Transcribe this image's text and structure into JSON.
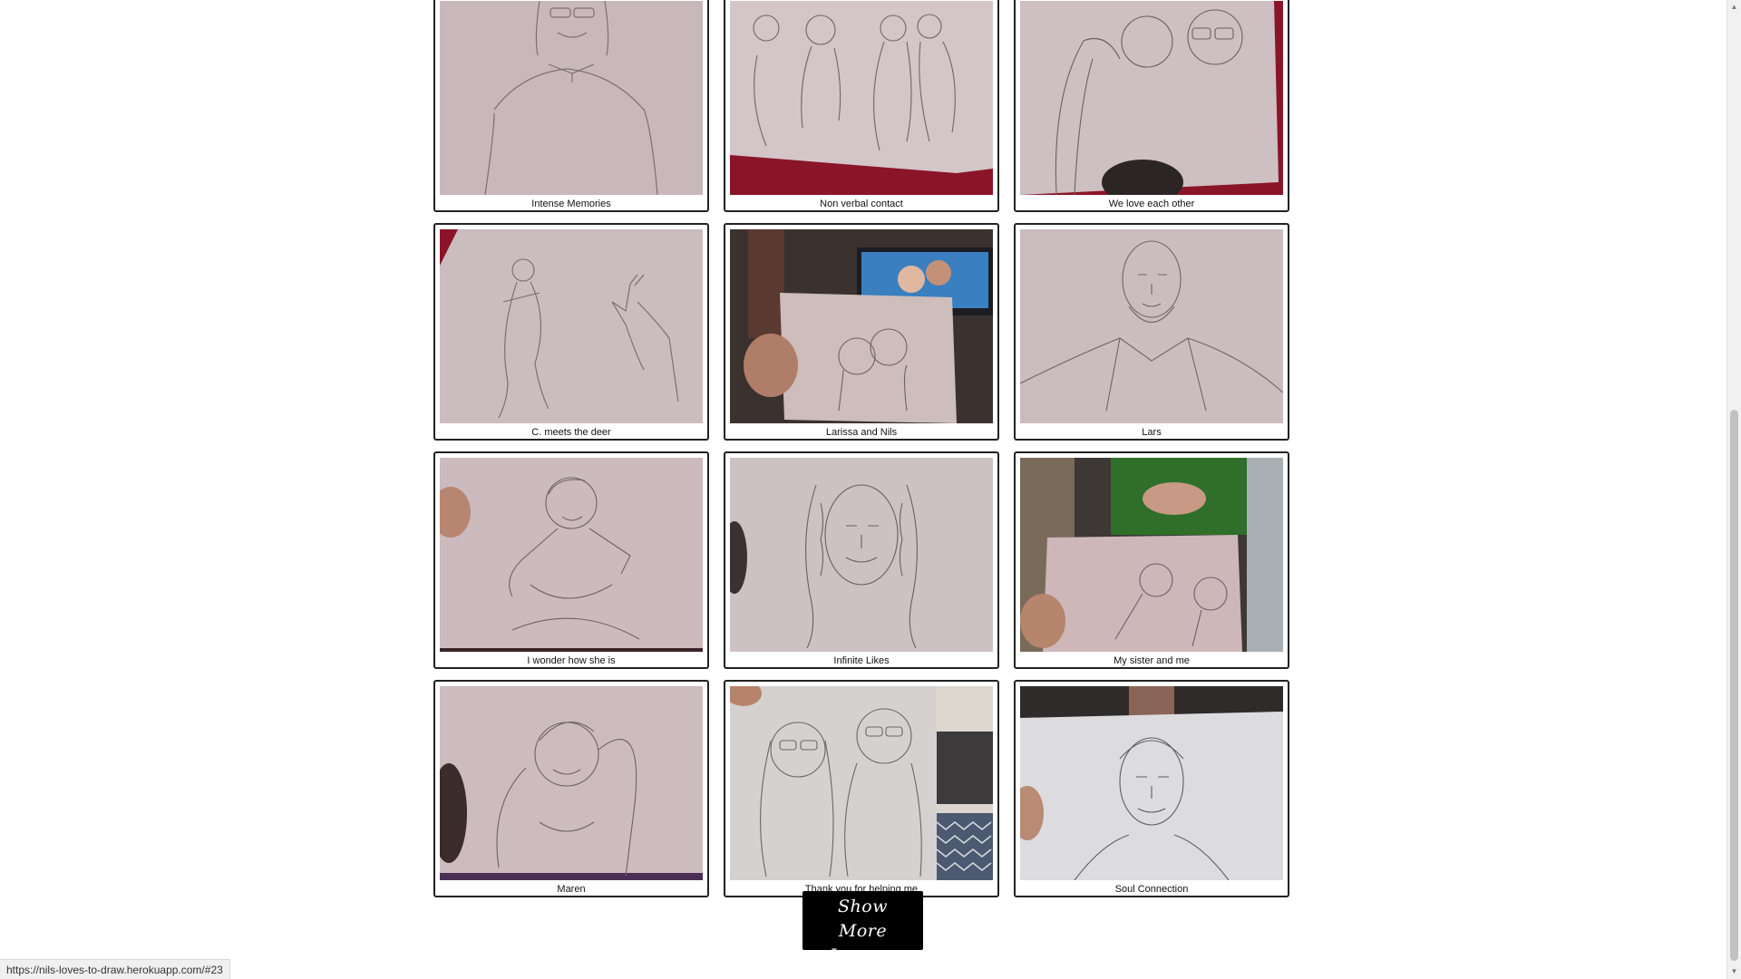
{
  "gallery": {
    "items": [
      {
        "caption": "Intense Memories"
      },
      {
        "caption": "Non verbal contact"
      },
      {
        "caption": "We love each other"
      },
      {
        "caption": "C. meets the deer"
      },
      {
        "caption": "Larissa and Nils"
      },
      {
        "caption": "Lars"
      },
      {
        "caption": "I wonder how she is"
      },
      {
        "caption": "Infinite Likes"
      },
      {
        "caption": "My sister and me"
      },
      {
        "caption": "Maren"
      },
      {
        "caption": "Thank you for helping me"
      },
      {
        "caption": "Soul Connection"
      }
    ]
  },
  "show_more": {
    "label": "Show More Images"
  },
  "status_bar": {
    "url": "https://nils-loves-to-draw.herokuapp.com/#23"
  },
  "colors": {
    "paper": "#cdbfc2",
    "sketch_line": "#6e6466",
    "red_backdrop": "#8a1528",
    "button_bg": "#000000"
  },
  "scrollbar": {
    "up_icon": "arrow-up",
    "down_icon": "arrow-down"
  }
}
